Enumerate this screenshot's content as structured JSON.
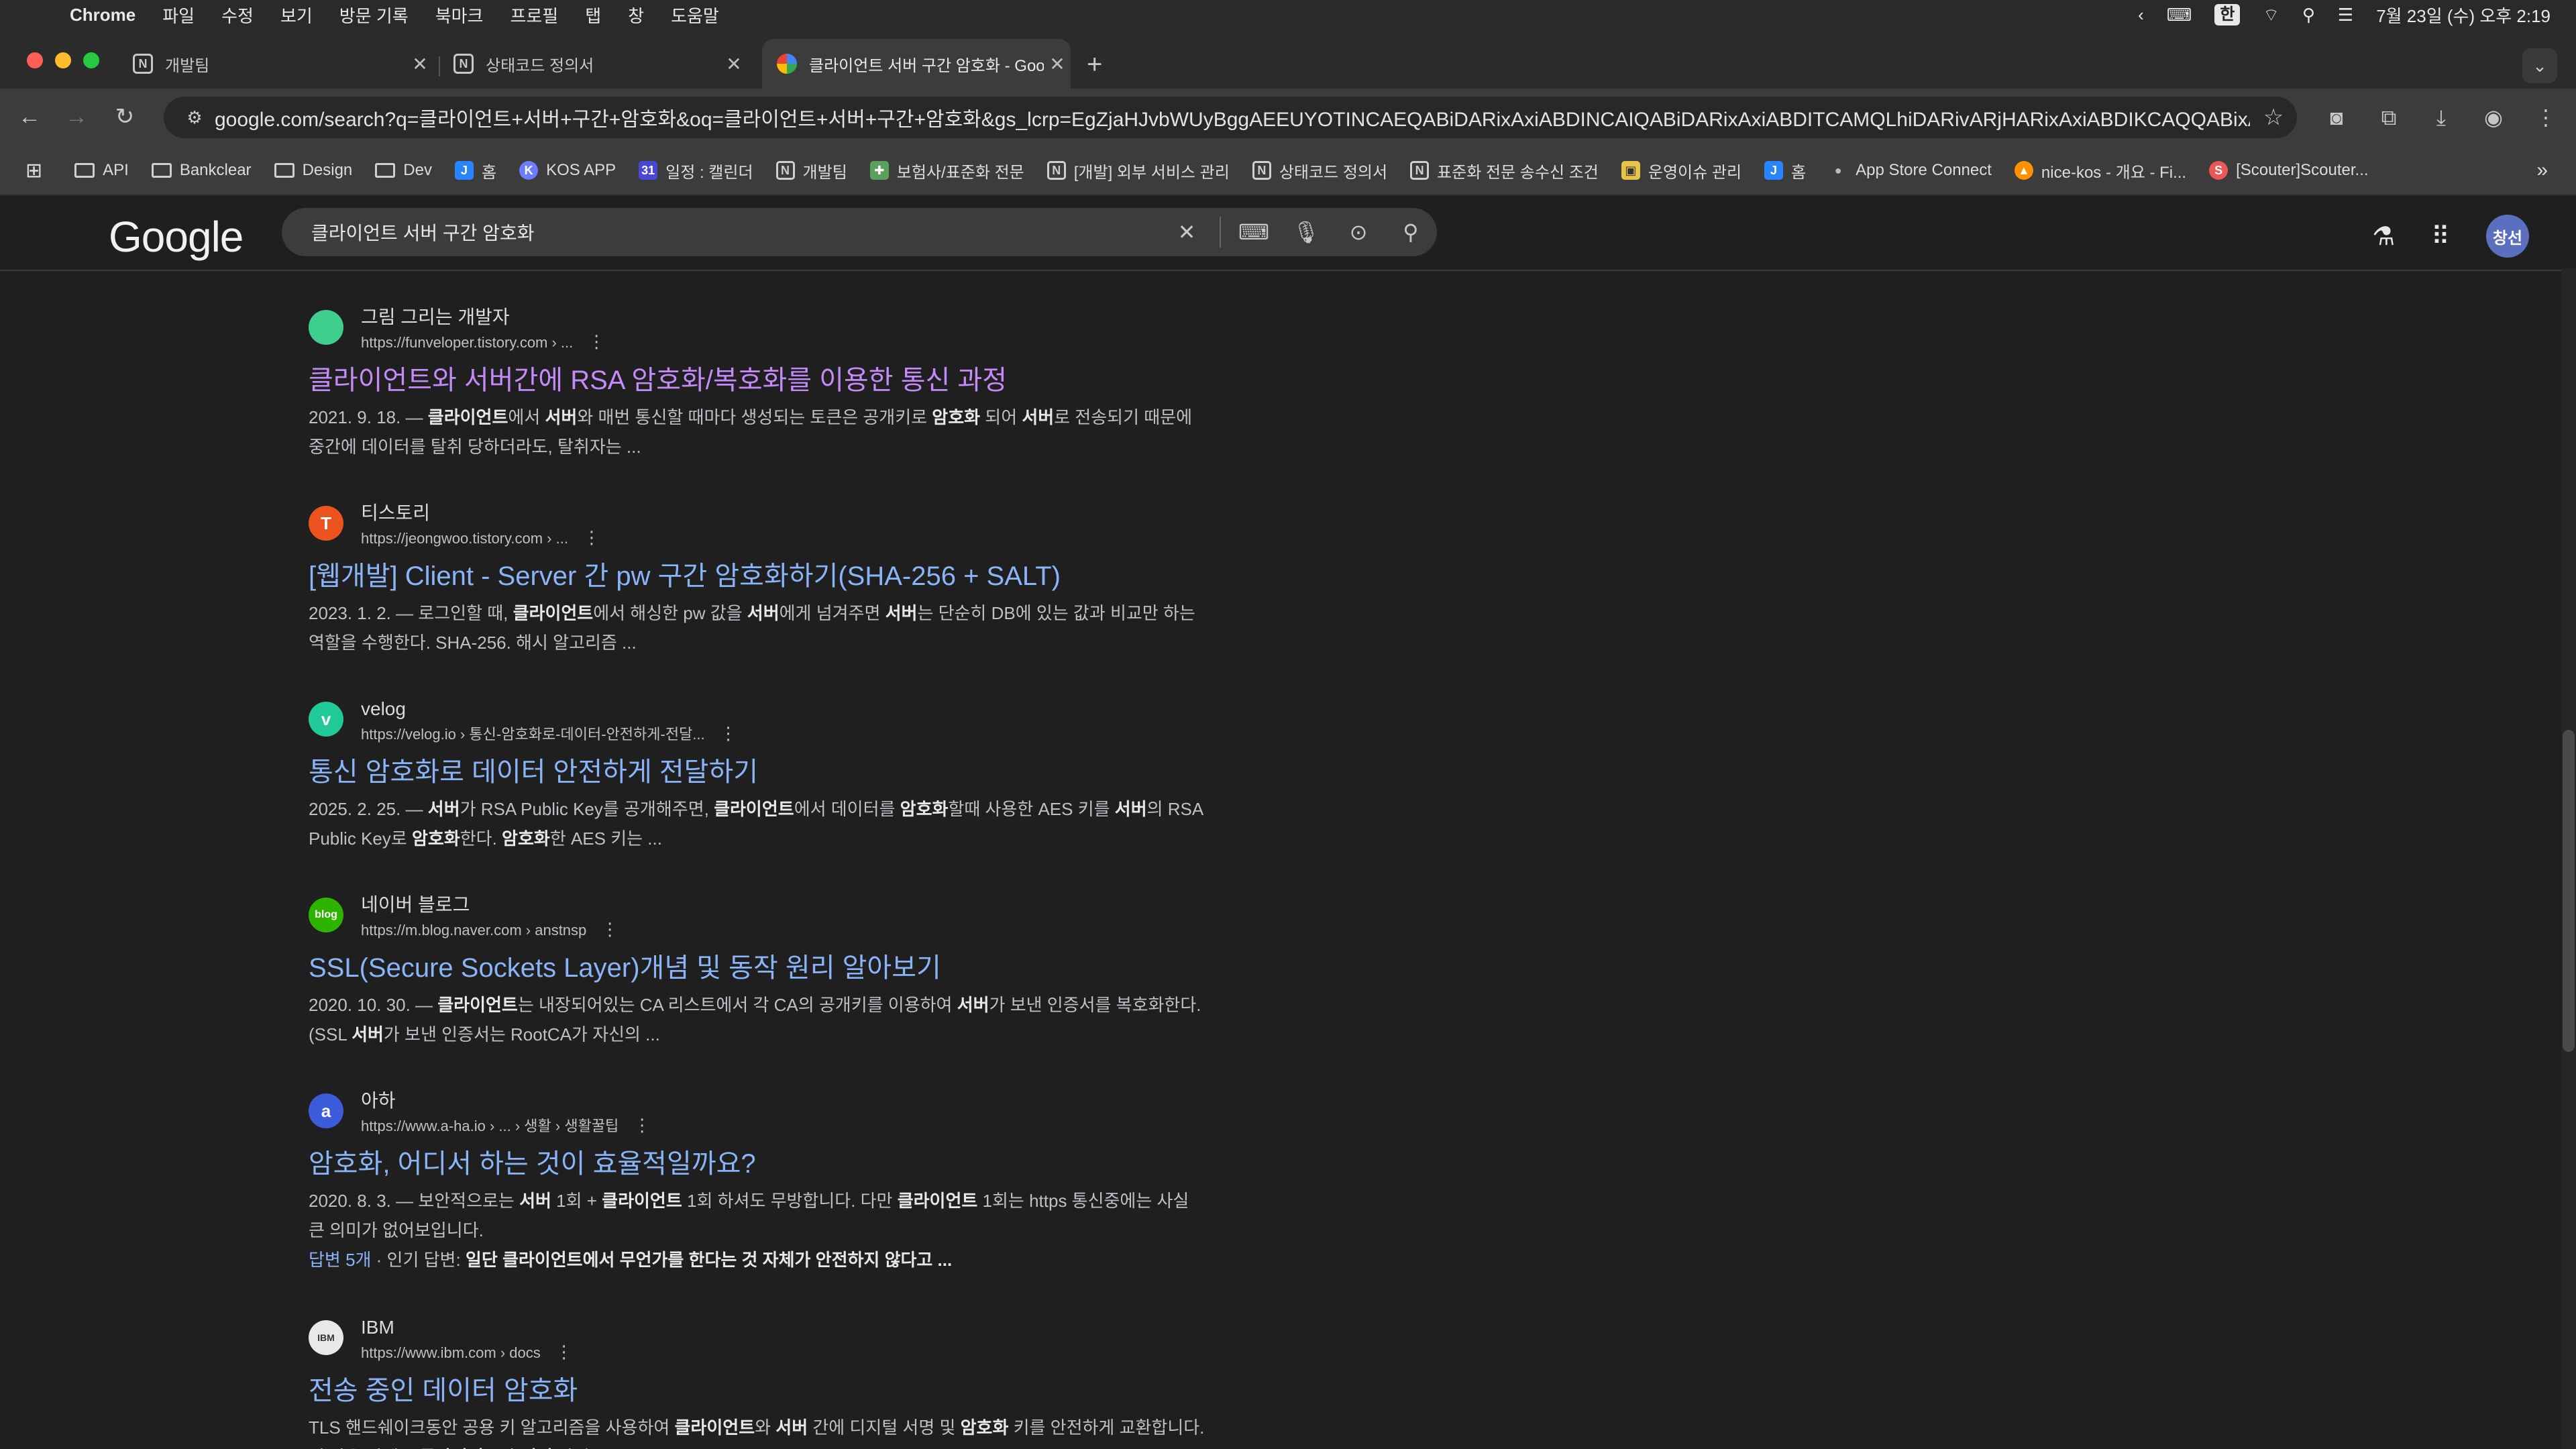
{
  "menubar": {
    "app": "Chrome",
    "items": [
      "파일",
      "수정",
      "보기",
      "방문 기록",
      "북마크",
      "프로필",
      "탭",
      "창",
      "도움말"
    ],
    "ime": "한",
    "clock": "7월 23일 (수) 오후 2:19"
  },
  "tabs": [
    {
      "title": "개발팀",
      "icon": "notion-icon"
    },
    {
      "title": "상태코드 정의서",
      "icon": "notion-icon"
    },
    {
      "title": "클라이언트 서버 구간 암호화 - Goo",
      "icon": "google-icon",
      "active": true
    }
  ],
  "omnibox": {
    "url": "google.com/search?q=클라이언트+서버+구간+암호화&oq=클라이언트+서버+구간+암호화&gs_lcrp=EgZjaHJvbWUyBggAEEUYOTINCAEQABiDARixAxiABDINCAIQABiDARixAxiABDITCAMQLhiDARivARjHARixAxiABDIKCAQQABixAxiABDIHC..."
  },
  "bookmarks": [
    {
      "label": "API",
      "icon": "folder-icon"
    },
    {
      "label": "Bankclear",
      "icon": "folder-icon"
    },
    {
      "label": "Design",
      "icon": "folder-icon"
    },
    {
      "label": "Dev",
      "icon": "folder-icon"
    },
    {
      "label": "홈",
      "icon": "jira-icon"
    },
    {
      "label": "KOS APP",
      "icon": "kos-icon"
    },
    {
      "label": "일정 : 캘린더",
      "icon": "calendar-icon"
    },
    {
      "label": "개발팀",
      "icon": "notion-icon"
    },
    {
      "label": "보험사/표준화 전문",
      "icon": "puzzle-icon"
    },
    {
      "label": "[개발] 외부 서비스 관리",
      "icon": "notion-icon"
    },
    {
      "label": "상태코드 정의서",
      "icon": "notion-icon"
    },
    {
      "label": "표준화 전문 송수신 조건",
      "icon": "notion-icon"
    },
    {
      "label": "운영이슈 관리",
      "icon": "image-icon"
    },
    {
      "label": "홈",
      "icon": "jira-icon"
    },
    {
      "label": "App Store Connect",
      "icon": "apple-icon"
    },
    {
      "label": "nice-kos - 개요 - Fi...",
      "icon": "firebase-icon"
    },
    {
      "label": "[Scouter]Scouter...",
      "icon": "scouter-icon"
    }
  ],
  "google": {
    "logo": "Google",
    "query": "클라이언트 서버 구간 암호화",
    "avatar": "창선"
  },
  "results": [
    {
      "site": "그림 그리는 개발자",
      "cite": "https://funveloper.tistory.com › ...",
      "title": "클라이언트와 서버간에 RSA 암호화/복호화를 이용한 통신 과정",
      "visited": true,
      "favicon_color": "#3ecf8e",
      "favicon_text": "",
      "snippet_html": "2021. 9. 18. — <b>클라이언트</b>에서 <b>서버</b>와 매번 통신할 때마다 생성되는 토큰은 공개키로 <b>암호화</b> 되어 <b>서버</b>로 전송되기 때문에 중간에 데이터를 탈취 당하더라도, 탈취자는 ..."
    },
    {
      "site": "티스토리",
      "cite": "https://jeongwoo.tistory.com › ...",
      "title": "[웹개발] Client - Server 간 pw 구간 암호화하기(SHA-256 + SALT)",
      "visited": false,
      "favicon_color": "#eb531f",
      "favicon_text": "T",
      "snippet_html": "2023. 1. 2. — 로그인할 때, <b>클라이언트</b>에서 해싱한 pw 값을 <b>서버</b>에게 넘겨주면 <b>서버</b>는 단순히 DB에 있는 값과 비교만 하는 역할을 수행한다. SHA-256. 해시 알고리즘 ..."
    },
    {
      "site": "velog",
      "cite": "https://velog.io › 통신-암호화로-데이터-안전하게-전달...",
      "title": "통신 암호화로 데이터 안전하게 전달하기",
      "visited": false,
      "favicon_color": "#20c997",
      "favicon_text": "v",
      "snippet_html": "2025. 2. 25. — <b>서버</b>가 RSA Public Key를 공개해주면, <b>클라이언트</b>에서 데이터를 <b>암호화</b>할때 사용한 AES 키를 <b>서버</b>의 RSA Public Key로 <b>암호화</b>한다. <b>암호화</b>한 AES 키는 ..."
    },
    {
      "site": "네이버 블로그",
      "cite": "https://m.blog.naver.com › anstnsp",
      "title": "SSL(Secure Sockets Layer)개념 및 동작 원리 알아보기",
      "visited": false,
      "favicon_color": "#2db400",
      "favicon_text": "blog",
      "snippet_html": "2020. 10. 30. — <b>클라이언트</b>는 내장되어있는 CA 리스트에서 각 CA의 공개키를 이용하여 <b>서버</b>가 보낸 인증서를 복호화한다. (SSL <b>서버</b>가 보낸 인증서는 RootCA가 자신의 ..."
    },
    {
      "site": "아하",
      "cite": "https://www.a-ha.io › ... › 생활 › 생활꿀팁",
      "title": "암호화, 어디서 하는 것이 효율적일까요?",
      "visited": false,
      "favicon_color": "#3b5bdb",
      "favicon_text": "a",
      "snippet_html": "2020. 8. 3. — 보안적으로는 <b>서버</b> 1회 + <b>클라이언트</b> 1회 하셔도 무방합니다. 다만 <b>클라이언트</b> 1회는 https 통신중에는 사실 큰 의미가 없어보입니다.<br><span class=\"link\">답변 5개</span> · 인기 답변: <b>일단 클라이언트에서 무언가를 한다는 것 자체가 안전하지 않다고 ...</b>"
    },
    {
      "site": "IBM",
      "cite": "https://www.ibm.com › docs",
      "title": "전송 중인 데이터 암호화",
      "visited": false,
      "favicon_color": "#e8e8e8",
      "favicon_text": "IBM",
      "snippet_html": "TLS 핸드쉐이크동안 공용 키 알고리즘을 사용하여 <b>클라이언트</b>와 <b>서버</b> 간에 디지털 서명 및 <b>암호화</b> 키를 안전하게 교환합니다. 이 다음 단계는 <b>클라이언트</b>와 <b>서버</b> 간의 ..."
    }
  ],
  "colors": {
    "link": "#8ab4f8",
    "visited": "#c58af9",
    "bg": "#1f1f1f"
  }
}
